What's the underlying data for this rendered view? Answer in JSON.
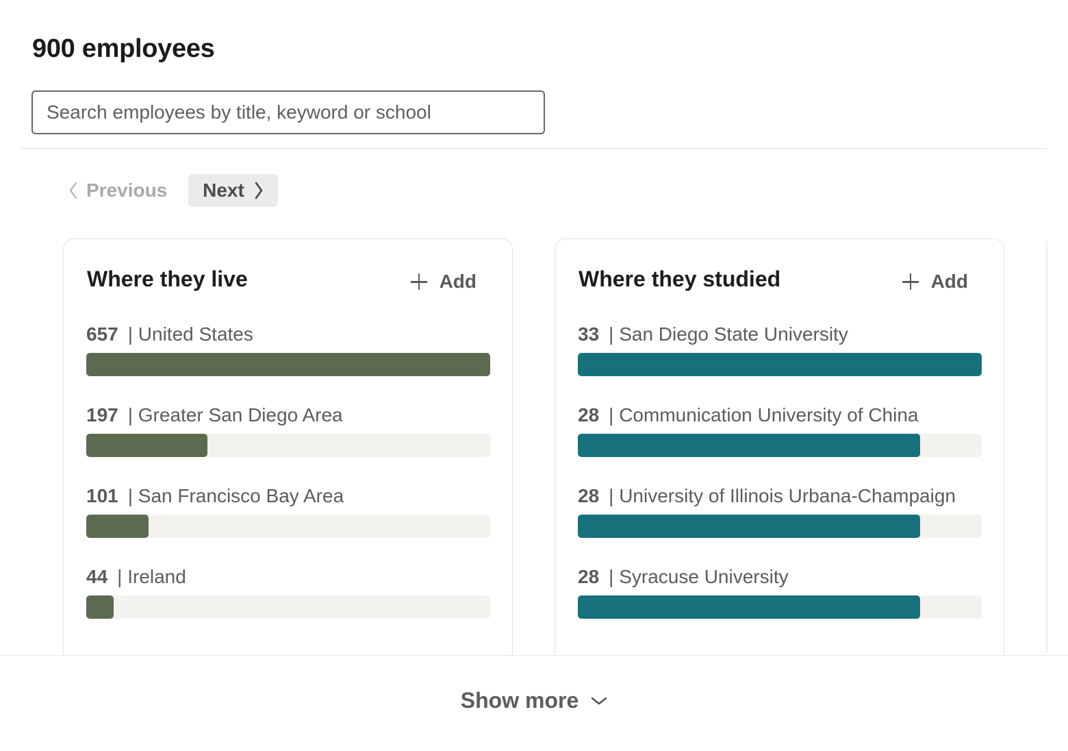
{
  "header": {
    "title": "900 employees",
    "search_placeholder": "Search employees by title, keyword or school"
  },
  "pager": {
    "previous_label": "Previous",
    "next_label": "Next",
    "previous_icon": "chevron-left-icon",
    "next_icon": "chevron-right-icon"
  },
  "cards": {
    "live": {
      "title": "Where they live",
      "add_label": "Add",
      "accent": "#5b6b4f",
      "items": [
        {
          "count": "657",
          "label": "| United States",
          "fraction": 1.0
        },
        {
          "count": "197",
          "label": "| Greater San Diego Area",
          "fraction": 0.3
        },
        {
          "count": "101",
          "label": "| San Francisco Bay Area",
          "fraction": 0.154
        },
        {
          "count": "44",
          "label": "| Ireland",
          "fraction": 0.067
        }
      ]
    },
    "studied": {
      "title": "Where they studied",
      "add_label": "Add",
      "accent": "#17717c",
      "items": [
        {
          "count": "33",
          "label": "| San Diego State University",
          "fraction": 1.0
        },
        {
          "count": "28",
          "label": "| Communication University of China",
          "fraction": 0.848
        },
        {
          "count": "28",
          "label": "| University of Illinois Urbana-Champaign",
          "fraction": 0.848
        },
        {
          "count": "28",
          "label": "| Syracuse University",
          "fraction": 0.848
        }
      ]
    }
  },
  "footer": {
    "show_more_label": "Show more",
    "show_more_icon": "chevron-down-icon"
  }
}
